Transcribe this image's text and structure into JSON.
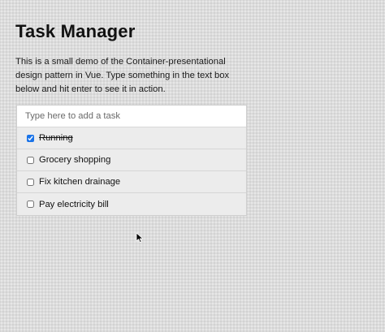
{
  "header": {
    "title": "Task Manager",
    "description": "This is a small demo of the Container-presentational design pattern in Vue. Type something in the text box below and hit enter to see it in action."
  },
  "task_input": {
    "placeholder": "Type here to add a task",
    "value": ""
  },
  "tasks": [
    {
      "label": "Running",
      "done": true
    },
    {
      "label": "Grocery shopping",
      "done": false
    },
    {
      "label": "Fix kitchen drainage",
      "done": false
    },
    {
      "label": "Pay electricity bill",
      "done": false
    }
  ],
  "colors": {
    "accent": "#1a73e8"
  },
  "icons": {
    "cursor": "mouse-pointer-icon"
  }
}
